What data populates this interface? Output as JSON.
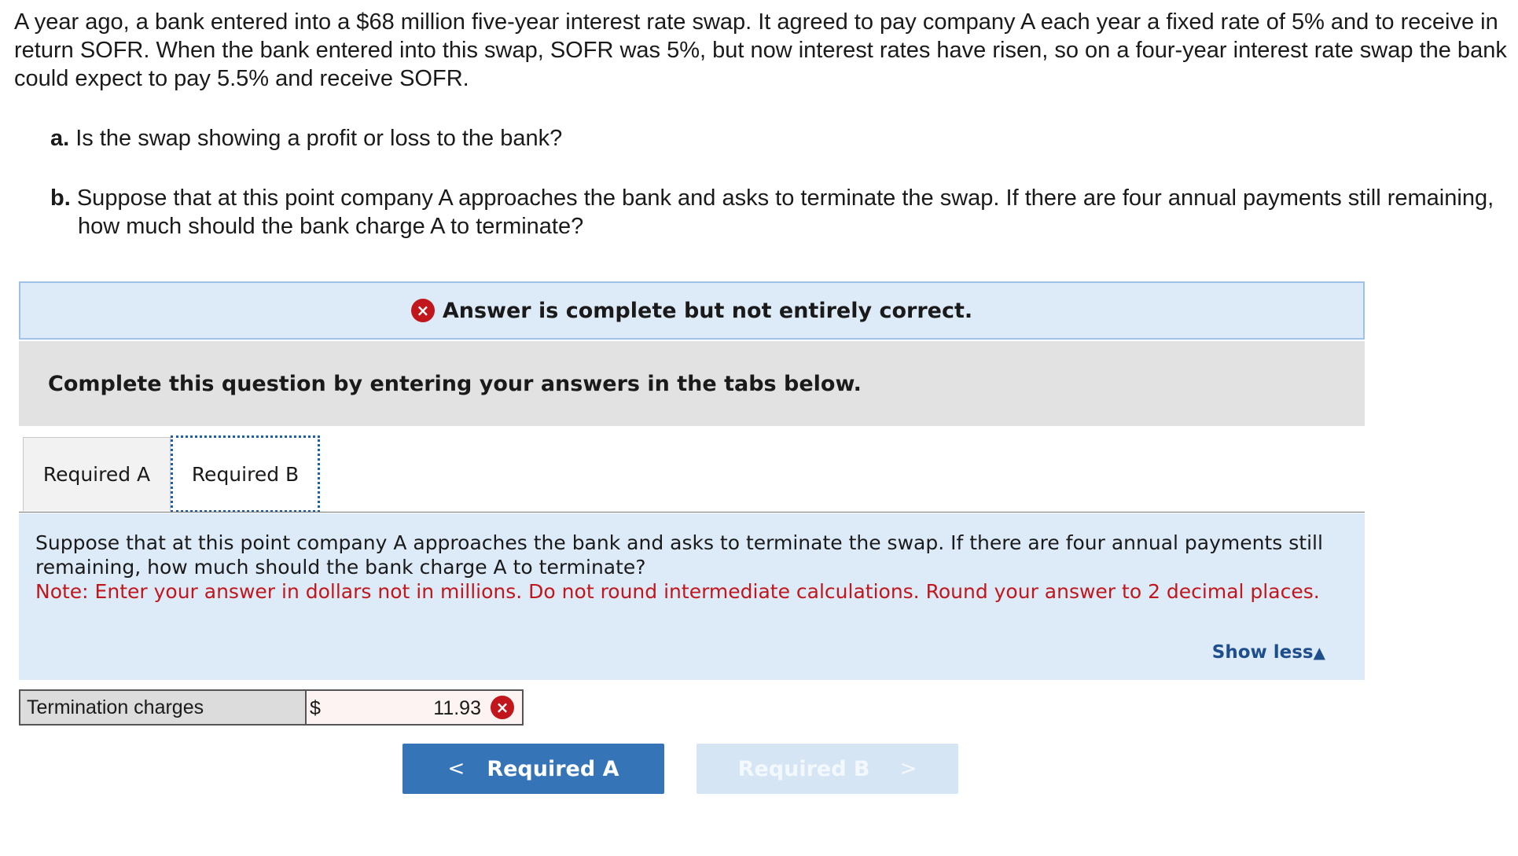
{
  "question": {
    "intro": "A year ago, a bank entered into a $68 million five-year interest rate swap. It agreed to pay company A each year a fixed rate of 5% and to receive in return SOFR. When the bank entered into this swap, SOFR was 5%, but now interest rates have risen, so on a four-year interest rate swap the bank could expect to pay 5.5% and receive SOFR.",
    "part_a_letter": "a.",
    "part_a_text": "Is the swap showing a profit or loss to the bank?",
    "part_b_letter": "b.",
    "part_b_text": "Suppose that at this point company A approaches the bank and asks to terminate the swap. If there are four annual payments still remaining, how much should the bank charge A to terminate?"
  },
  "status": {
    "icon": "x-circle-icon",
    "icon_glyph": "×",
    "message": "Answer is complete but not entirely correct.",
    "color": "#c0161c"
  },
  "instructions": "Complete this question by entering your answers in the tabs below.",
  "tabs": [
    {
      "label": "Required A",
      "active": false
    },
    {
      "label": "Required B",
      "active": true
    }
  ],
  "panel": {
    "prompt": "Suppose that at this point company A approaches the bank and asks to terminate the swap. If there are four annual payments still remaining, how much should the bank charge A to terminate?",
    "note": "Note: Enter your answer in dollars not in millions. Do not round intermediate calculations. Round your answer to 2 decimal places.",
    "toggle_label": "Show less",
    "toggle_icon": "▲"
  },
  "answer": {
    "label": "Termination charges",
    "currency": "$",
    "value": "11.93",
    "status_icon": "×"
  },
  "navigation": {
    "prev_label": "Required A",
    "prev_chevron": "<",
    "next_label": "Required B",
    "next_chevron": ">"
  },
  "colors": {
    "accent": "#3674b8",
    "panel_bg": "#ddeaf7",
    "error": "#c0161c",
    "link": "#1f4e8c"
  }
}
